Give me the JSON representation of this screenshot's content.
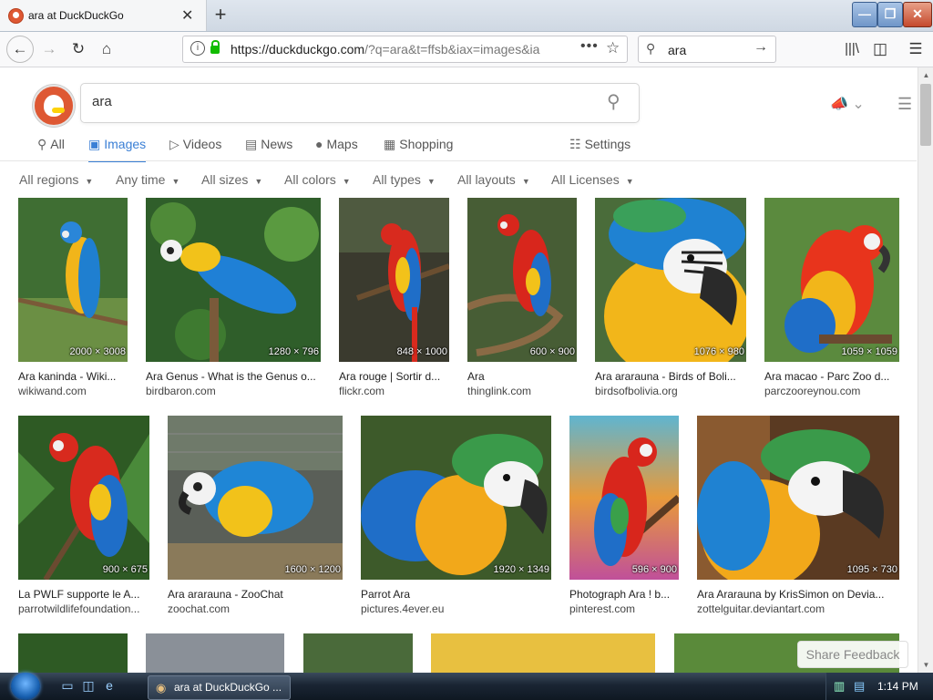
{
  "browser": {
    "tab_title": "ara at DuckDuckGo",
    "close_tab": "✕",
    "new_tab": "+",
    "url_host": "https://duckduckgo.com",
    "url_path": "/?q=ara&t=ffsb&iax=images&ia",
    "search_value": "ara",
    "window_min": "—",
    "window_max": "❐",
    "window_close": "✕"
  },
  "ddg": {
    "query": "ara",
    "tabs": [
      {
        "label": "All",
        "icon": "search-icon"
      },
      {
        "label": "Images",
        "icon": "image-icon"
      },
      {
        "label": "Videos",
        "icon": "play-icon"
      },
      {
        "label": "News",
        "icon": "news-icon"
      },
      {
        "label": "Maps",
        "icon": "map-pin-icon"
      },
      {
        "label": "Shopping",
        "icon": "shopping-bag-icon"
      }
    ],
    "settings_label": "Settings",
    "filters": [
      "All regions",
      "Any time",
      "All sizes",
      "All colors",
      "All types",
      "All layouts",
      "All Licenses"
    ],
    "share_feedback": "Share Feedback"
  },
  "results": [
    {
      "title": "Ara kaninda - Wiki...",
      "source": "wikiwand.com",
      "dims": "2000 × 3008",
      "bg": "#3f6e33"
    },
    {
      "title": "Ara Genus - What is the Genus o...",
      "source": "birdbaron.com",
      "dims": "1280 × 796",
      "bg": "#2f5e2a"
    },
    {
      "title": "Ara rouge | Sortir d...",
      "source": "flickr.com",
      "dims": "848 × 1000",
      "bg": "#3a3a2e"
    },
    {
      "title": "Ara",
      "source": "thinglink.com",
      "dims": "600 × 900",
      "bg": "#556b3a"
    },
    {
      "title": "Ara ararauna - Birds of Boli...",
      "source": "birdsofbolivia.org",
      "dims": "1076 × 980",
      "bg": "#4a6c3a"
    },
    {
      "title": "Ara macao - Parc Zoo d...",
      "source": "parczooreynou.com",
      "dims": "1059 × 1059",
      "bg": "#5b8a3e"
    },
    {
      "title": "La PWLF supporte le A...",
      "source": "parrotwildlifefoundation...",
      "dims": "900 × 675",
      "bg": "#2e5a24"
    },
    {
      "title": "Ara ararauna - ZooChat",
      "source": "zoochat.com",
      "dims": "1600 × 1200",
      "bg": "#5a5f58"
    },
    {
      "title": "Parrot Ara",
      "source": "pictures.4ever.eu",
      "dims": "1920 × 1349",
      "bg": "#3d5a2a"
    },
    {
      "title": "Photograph Ara ! b...",
      "source": "pinterest.com",
      "dims": "596 × 900",
      "bg": "#c77a3a"
    },
    {
      "title": "Ara Ararauna by KrisSimon on Devia...",
      "source": "zottelguitar.deviantart.com",
      "dims": "1095 × 730",
      "bg": "#5a3a22"
    }
  ],
  "taskbar": {
    "window_label": "ara at DuckDuckGo ...",
    "clock": "1:14 PM"
  }
}
